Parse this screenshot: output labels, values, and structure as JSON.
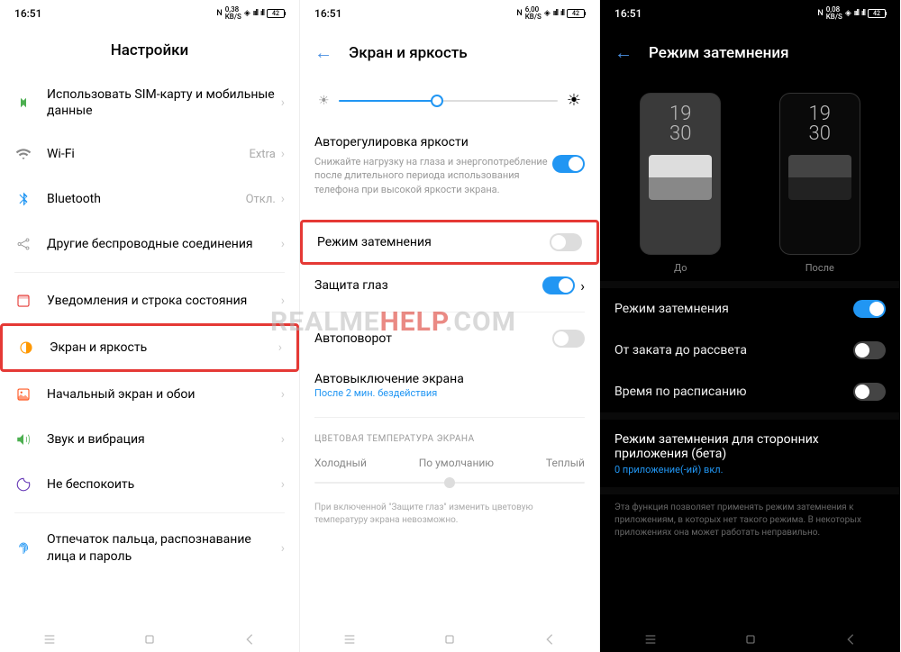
{
  "statusbar": {
    "time": "16:51",
    "speeds": [
      "0,38",
      "6,00",
      "0,08"
    ],
    "speed_unit": "KB/S",
    "battery": "42"
  },
  "screen1": {
    "title": "Настройки",
    "items": [
      {
        "icon": "sim-icon",
        "label": "Использовать SIM-карту и мобильные данные"
      },
      {
        "icon": "wifi-icon",
        "label": "Wi-Fi",
        "extra": "Extra"
      },
      {
        "icon": "bluetooth-icon",
        "label": "Bluetooth",
        "extra": "Откл."
      },
      {
        "icon": "wireless-icon",
        "label": "Другие беспроводные соединения"
      },
      {
        "icon": "notification-icon",
        "label": "Уведомления и строка состояния"
      },
      {
        "icon": "display-icon",
        "label": "Экран и яркость",
        "highlight": true
      },
      {
        "icon": "home-icon",
        "label": "Начальный экран и обои"
      },
      {
        "icon": "sound-icon",
        "label": "Звук и вибрация"
      },
      {
        "icon": "dnd-icon",
        "label": "Не беспокоить"
      },
      {
        "icon": "fingerprint-icon",
        "label": "Отпечаток пальца, распознавание лица и пароль"
      }
    ]
  },
  "screen2": {
    "title": "Экран и яркость",
    "auto_brightness": {
      "title": "Авторегулировка яркости",
      "desc": "Снижайте нагрузку на глаза и энергопотребление после длительного периода использования телефона при высокой яркости экрана."
    },
    "dark_mode": {
      "label": "Режим затемнения"
    },
    "eye_protect": {
      "label": "Защита глаз"
    },
    "auto_rotate": {
      "label": "Автоповорот"
    },
    "auto_off": {
      "label": "Автовыключение экрана",
      "value": "После 2 мин. бездействия"
    },
    "color_temp": {
      "header": "ЦВЕТОВАЯ ТЕМПЕРАТУРА ЭКРАНА",
      "cold": "Холодный",
      "default": "По умолчанию",
      "warm": "Теплый"
    },
    "footnote": "При включенной \"Защите глаз\" изменить цветовую температуру экрана невозможно."
  },
  "screen3": {
    "title": "Режим затемнения",
    "preview_time": [
      "19",
      "30"
    ],
    "preview_before": "До",
    "preview_after": "После",
    "dark_mode": "Режим затемнения",
    "sunset": "От заката до рассвета",
    "schedule": "Время по расписанию",
    "third_party": {
      "title": "Режим затемнения для сторонних приложения (бета)",
      "subtitle": "0 приложение(-ий) вкл."
    },
    "footnote": "Эта функция позволяет применять режим затемнения к приложениям, в которых нет такого режима. В некоторых приложениях она может работать неправильно."
  },
  "watermark": {
    "part1": "REALME",
    "part2": "HELP",
    "part3": ".COM"
  }
}
